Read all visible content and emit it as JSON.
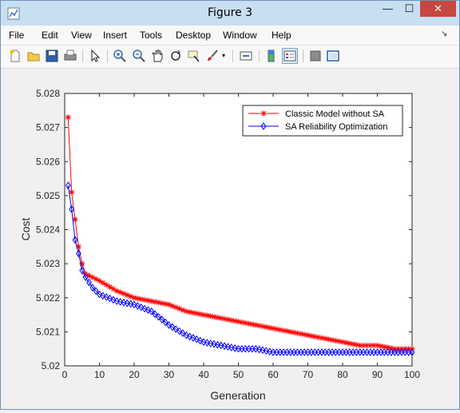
{
  "window": {
    "title": "Figure 3",
    "minimize_glyph": "—",
    "maximize_glyph": "☐",
    "close_glyph": "✕"
  },
  "menu": {
    "items": [
      "File",
      "Edit",
      "View",
      "Insert",
      "Tools",
      "Desktop",
      "Window",
      "Help"
    ],
    "dock_glyph": "↘"
  },
  "toolbar": {
    "icons": [
      "new-figure-icon",
      "open-file-icon",
      "save-icon",
      "print-icon",
      "edit-plot-icon",
      "zoom-in-icon",
      "zoom-out-icon",
      "pan-icon",
      "rotate-3d-icon",
      "data-cursor-icon",
      "brush-icon",
      "brush-dropdown-icon",
      "link-plot-icon",
      "insert-colorbar-icon",
      "insert-legend-icon",
      "hide-plot-tools-icon",
      "show-plot-tools-icon"
    ]
  },
  "colors": {
    "series1": "#ff0000",
    "series2": "#0000ff",
    "close_button": "#c7463f",
    "titlebar": "#c8dff2"
  },
  "chart_data": {
    "type": "line",
    "title": "",
    "xlabel": "Generation",
    "ylabel": "Cost",
    "xlim": [
      0,
      100
    ],
    "ylim": [
      5.02,
      5.028
    ],
    "xticks": [
      "0",
      "10",
      "20",
      "30",
      "40",
      "50",
      "60",
      "70",
      "80",
      "90",
      "100"
    ],
    "yticks": [
      "5.02",
      "5.021",
      "5.022",
      "5.023",
      "5.024",
      "5.025",
      "5.026",
      "5.027",
      "5.028"
    ],
    "grid": false,
    "legend_position": "top-right",
    "x": [
      1,
      2,
      3,
      4,
      5,
      6,
      8,
      10,
      15,
      20,
      25,
      30,
      35,
      40,
      45,
      50,
      55,
      60,
      65,
      70,
      75,
      80,
      85,
      90,
      95,
      100
    ],
    "series": [
      {
        "name": "Classic Model without SA",
        "marker": "star",
        "values": [
          5.0273,
          5.0251,
          5.0243,
          5.0235,
          5.023,
          5.0227,
          5.0226,
          5.0225,
          5.0222,
          5.022,
          5.0219,
          5.0218,
          5.0216,
          5.0215,
          5.0214,
          5.0213,
          5.0212,
          5.0211,
          5.021,
          5.0209,
          5.0208,
          5.0207,
          5.0206,
          5.0206,
          5.0205,
          5.0205
        ]
      },
      {
        "name": "SA Reliability Optimization",
        "marker": "diamond",
        "values": [
          5.0253,
          5.0246,
          5.0237,
          5.0233,
          5.0228,
          5.0226,
          5.0223,
          5.0221,
          5.0219,
          5.0218,
          5.0216,
          5.0212,
          5.0209,
          5.0207,
          5.0206,
          5.0205,
          5.0205,
          5.0204,
          5.0204,
          5.0204,
          5.0204,
          5.0204,
          5.0204,
          5.0204,
          5.0204,
          5.0204
        ]
      }
    ]
  }
}
